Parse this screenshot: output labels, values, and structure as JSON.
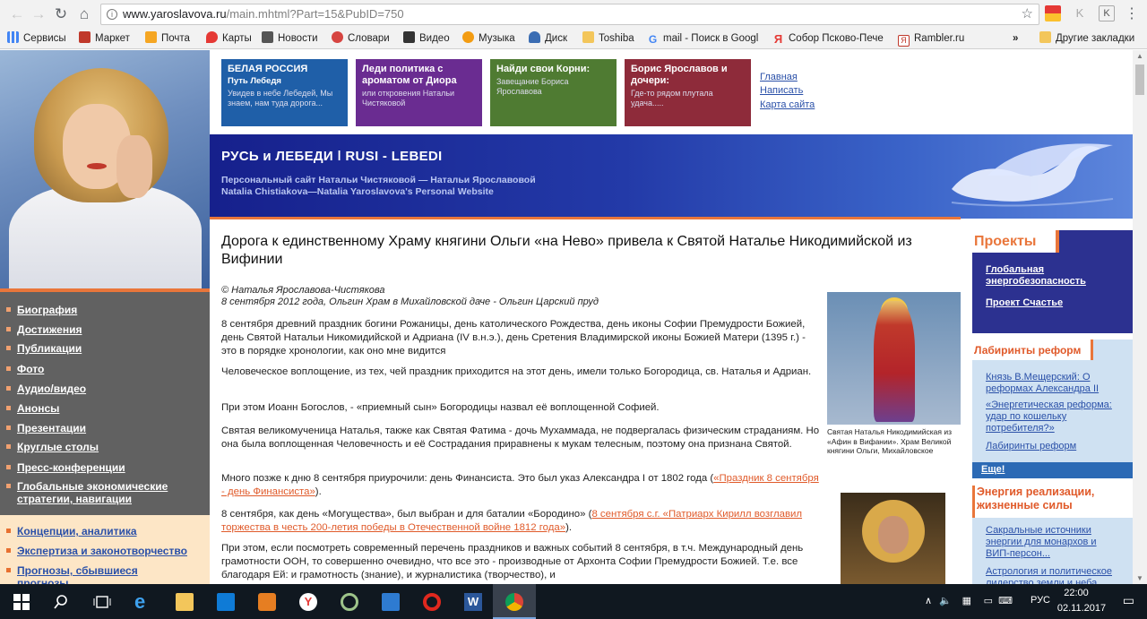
{
  "browser": {
    "url_host": "www.yaroslavova.ru",
    "url_path": "/main.mhtml?Part=15&PubID=750",
    "bookmarks": [
      {
        "label": "Сервисы",
        "icon": "apps-grid-icon",
        "color": "#4285f4"
      },
      {
        "label": "Маркет",
        "icon": "market-icon",
        "color": "#c0392b"
      },
      {
        "label": "Почта",
        "icon": "mail-icon",
        "color": "#f5a623"
      },
      {
        "label": "Карты",
        "icon": "map-pin-icon",
        "color": "#e53935"
      },
      {
        "label": "Новости",
        "icon": "news-icon",
        "color": "#555555"
      },
      {
        "label": "Словари",
        "icon": "dictionary-icon",
        "color": "#d64541"
      },
      {
        "label": "Видео",
        "icon": "video-icon",
        "color": "#333333"
      },
      {
        "label": "Музыка",
        "icon": "music-icon",
        "color": "#f39c12"
      },
      {
        "label": "Диск",
        "icon": "cloud-disk-icon",
        "color": "#3b6db3"
      },
      {
        "label": "Toshiba",
        "icon": "folder-icon",
        "color": "#f3c65b"
      },
      {
        "label": "mail - Поиск в Googl",
        "icon": "google-icon",
        "color": "#4285f4"
      },
      {
        "label": "Собор Псково-Пече",
        "icon": "yandex-icon",
        "color": "#e53935"
      },
      {
        "label": "Rambler.ru",
        "icon": "rambler-icon",
        "color": "#c0392b"
      }
    ],
    "more_bookmarks": "»",
    "other_bookmarks": "Другие закладки"
  },
  "top_boxes": [
    {
      "title": "БЕЛАЯ РОССИЯ",
      "subtitle": "Путь Лебедя",
      "text": "Увидев в небе Лебедей, Мы знаем, нам туда дорога...",
      "color": "#1f5fa8"
    },
    {
      "title": "Леди политика с ароматом от Диора",
      "subtitle": "",
      "text": "или откровения Натальи Чистяковой",
      "color": "#6a2c91"
    },
    {
      "title": "Найди свои Корни:",
      "subtitle": "",
      "text": "Завещание Бориса Ярославова",
      "color": "#4f7b32"
    },
    {
      "title": "Борис Ярославов и дочери:",
      "subtitle": "",
      "text": "Где-то рядом плутала удача.....",
      "color": "#8e2b3a"
    }
  ],
  "top_links": [
    "Главная",
    "Написать",
    "Карта сайта"
  ],
  "hero": {
    "title": "РУСЬ и ЛЕБЕДИ ǀ RUSI - LEBEDI",
    "sub1": "Персональный сайт Натальи Чистяковой — Натальи Ярославовой",
    "sub2": "Natalia Chistiakova—Natalia Yaroslavova's Personal Website"
  },
  "left_nav": [
    "Биография",
    "Достижения",
    "Публикации",
    "Фото",
    "Аудио/видео",
    "Анонсы",
    "Презентации",
    "Круглые столы",
    "Пресс-конференции",
    "Глобальные экономические стратегии, навигации"
  ],
  "left_nav2": [
    "Концепции, аналитика",
    "Экспертиза и законотворчество",
    "Прогнозы, сбывшиеся прогнозы"
  ],
  "article": {
    "title": "Дорога к единственному Храму княгини Ольги «на Нево» привела к Святой Наталье Никодимийской из Вифинии",
    "author": "© Наталья Ярославова-Чистякова",
    "date": "8 сентября 2012 года, Ольгин Храм в Михайловской даче - Ольгин Царский пруд",
    "p1": "8 сентября древний праздник богини Рожаницы, день католического Рождества, день иконы Софии Премудрости Божией, день Святой Натальи Никомидийской и Адриана (IV в.н.э.), день Сретения Владимирской иконы Божией Матери (1395 г.) - это в порядке хронологии, как оно мне видится",
    "p2": "Человеческое воплощение, из тех, чей праздник приходится на этот день, имели только Богородица, св. Наталья и Адриан.",
    "p3": "При этом Иоанн Богослов, - «приемный сын» Богородицы назвал её воплощенной Софией.",
    "p4": "Святая великомученица Наталья, также как Святая Фатима - дочь Мухаммада, не подвергалась физическим страданиям. Но она была воплощенная Человечность и её Сострадания приравнены к мукам телесным, поэтому она признана Святой.",
    "p5_text": "Много позже к дню 8 сентября приурочили: день Финансиста. Это был указ Александра I от 1802 года (",
    "p5_link": "«Праздник 8 сентября - день Финансиста»",
    "p5_end": ").",
    "p6_text": "8 сентября, как день «Могущества», был выбран и для баталии «Бородино» (",
    "p6_link": "8 сентября с.г. «Патриарх Кирилл возглавил торжества в честь 200-летия победы в Отечественной войне 1812 года»",
    "p6_end": ").",
    "p7": "При этом, если посмотреть современный перечень праздников и важных событий 8 сентября, в т.ч. Международный день грамотности ООН, то совершенно очевидно, что все это - производные от Архонта Софии Премудрости Божией. Т.е. все благодаря Ей: и грамотность (знание), и журналистика (творчество), и",
    "img1_caption": "Святая Наталья Никодимийская из «Афин в Вифании». Храм Великой княгини Ольги, Михайловское"
  },
  "right": {
    "projects_title": "Проекты",
    "projects": [
      "Глобальная энергобезопасность",
      "Проект Счастье"
    ],
    "reforms_title": "Лабиринты реформ",
    "reforms": [
      "Князь В.Мещерский: О реформах Александра II",
      "«Энергетическая реформа: удар по кошельку потребителя?»",
      "Лабиринты реформ"
    ],
    "more": "Еще!",
    "energy_title": "Энергия реализации, жизненные силы",
    "energy": [
      "Сакральные источники энергии для монархов и ВИП-персон...",
      "Астрология и политическое лидерство земли и неба"
    ]
  },
  "taskbar": {
    "time": "22:00",
    "date": "02.11.2017",
    "lang": "РУС"
  }
}
